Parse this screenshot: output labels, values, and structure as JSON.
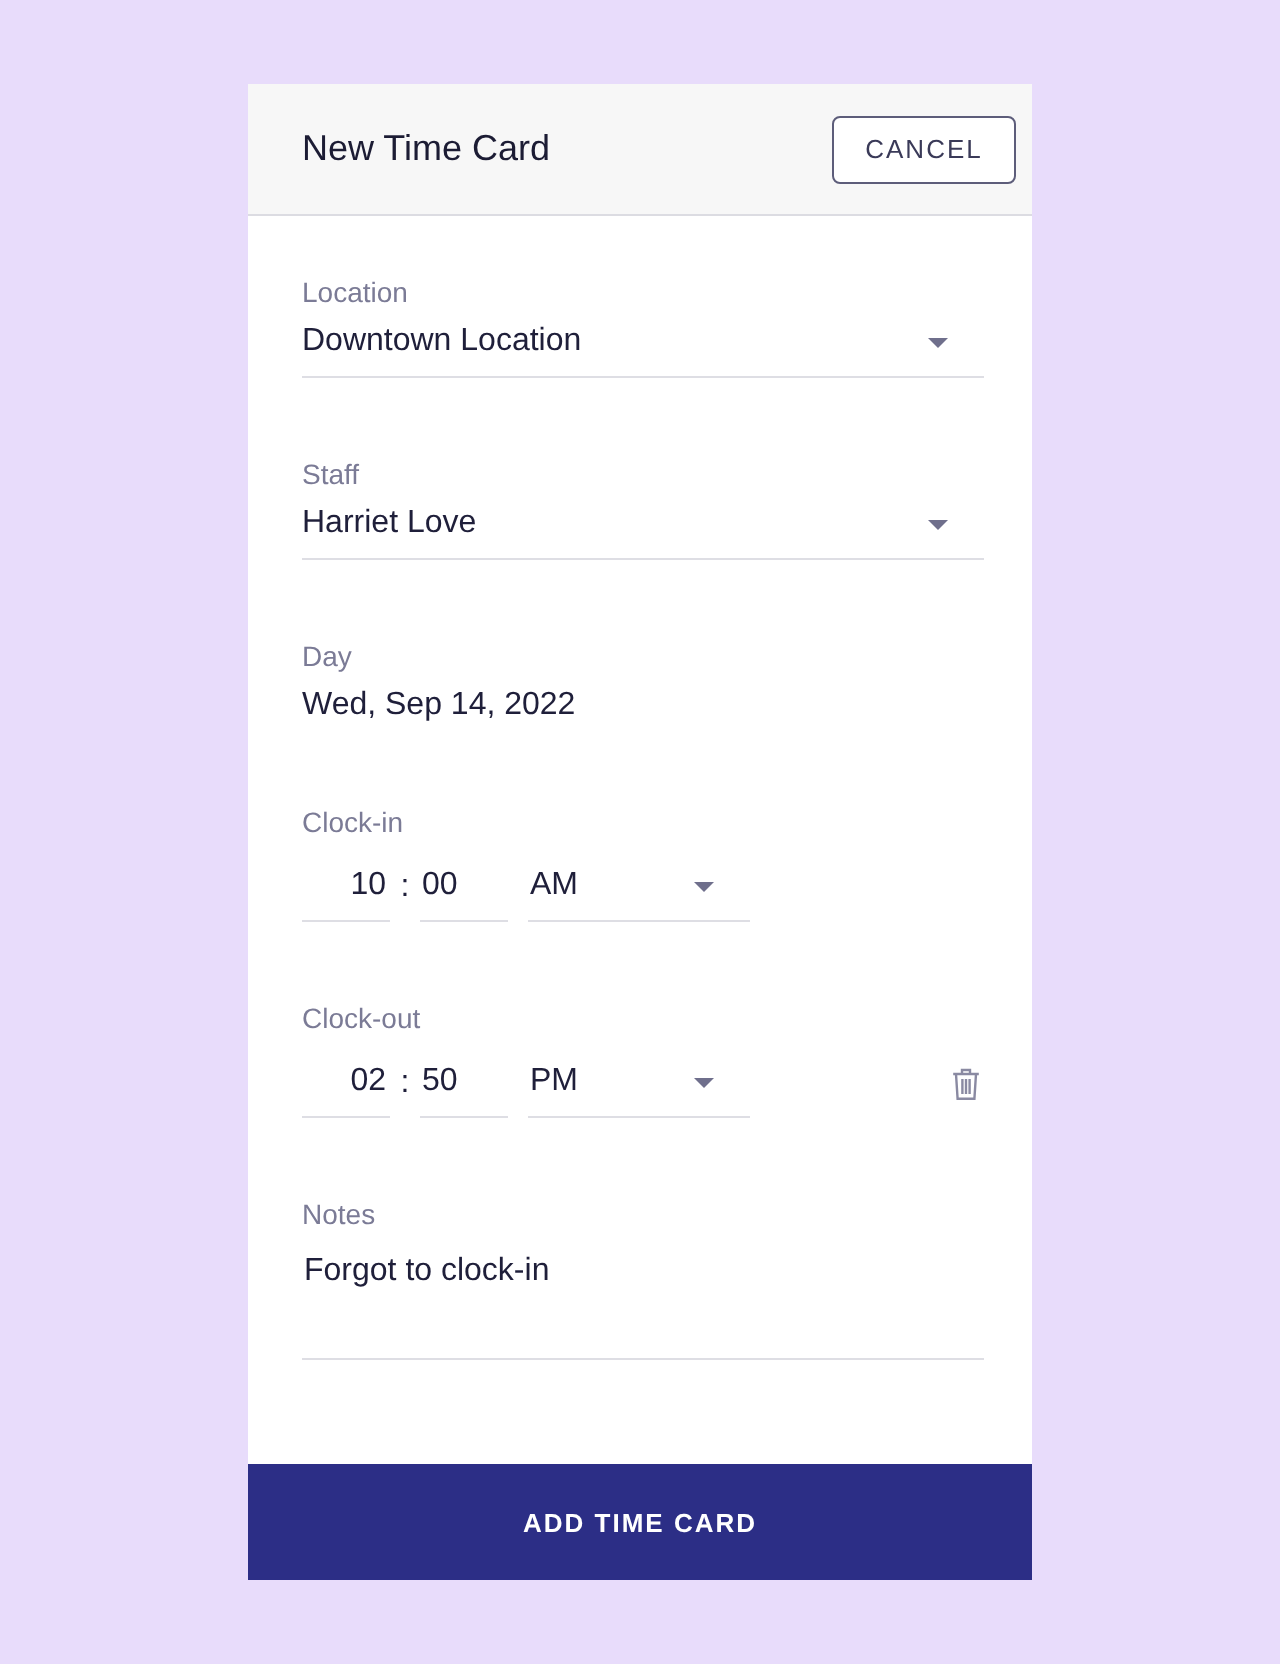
{
  "header": {
    "title": "New Time Card",
    "cancel_button": "CANCEL"
  },
  "fields": [
    {
      "kind": "select",
      "label": "Location",
      "value": "Downtown Location"
    },
    {
      "kind": "select",
      "label": "Staff",
      "value": "Harriet Love"
    },
    {
      "kind": "text",
      "label": "Day",
      "value": "Wed, Sep 14, 2022"
    },
    {
      "kind": "time",
      "label": "Clock-in",
      "hour": "10",
      "separator": ":",
      "minute": "00",
      "period": "AM",
      "deletable": false
    },
    {
      "kind": "time",
      "label": "Clock-out",
      "hour": "02",
      "separator": ":",
      "minute": "50",
      "period": "PM",
      "deletable": true
    },
    {
      "kind": "textarea",
      "label": "Notes",
      "value": "Forgot to clock-in"
    }
  ],
  "submit_button": "ADD TIME CARD"
}
